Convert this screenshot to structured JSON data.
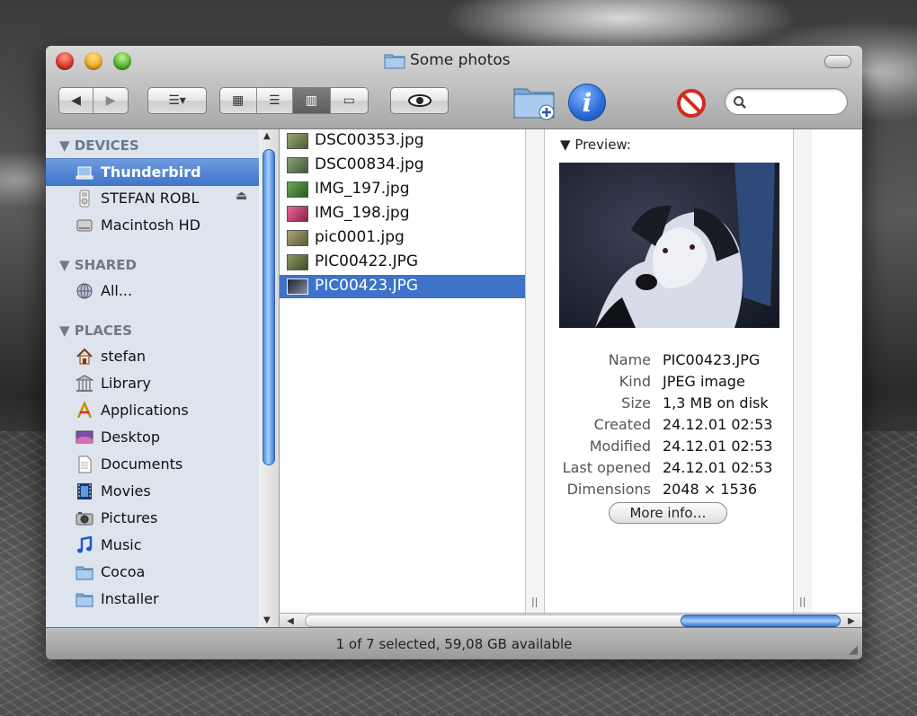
{
  "window": {
    "title": "Some photos"
  },
  "toolbar": {
    "back_label": "◀",
    "forward_label": "▶",
    "arrange_label": "☰▾",
    "view_icons": "▦",
    "view_list": "☰",
    "view_columns": "▥",
    "view_coverflow": "▭",
    "quicklook": "👁",
    "new_folder_icon": "folder-plus-icon",
    "info_label": "i",
    "delete_icon": "no-entry-icon",
    "search": {
      "value": "",
      "placeholder": ""
    }
  },
  "sidebar": {
    "sections": [
      {
        "header": "DEVICES",
        "items": [
          {
            "label": "Thunderbird",
            "icon": "laptop-icon",
            "selected": true
          },
          {
            "label": "STEFAN ROBL",
            "icon": "ipod-icon",
            "eject": true
          },
          {
            "label": "Macintosh HD",
            "icon": "hard-drive-icon"
          }
        ]
      },
      {
        "header": "SHARED",
        "items": [
          {
            "label": "All...",
            "icon": "network-globe-icon"
          }
        ]
      },
      {
        "header": "PLACES",
        "items": [
          {
            "label": "stefan",
            "icon": "home-icon"
          },
          {
            "label": "Library",
            "icon": "library-icon"
          },
          {
            "label": "Applications",
            "icon": "applications-icon"
          },
          {
            "label": "Desktop",
            "icon": "desktop-icon"
          },
          {
            "label": "Documents",
            "icon": "documents-icon"
          },
          {
            "label": "Movies",
            "icon": "film-icon"
          },
          {
            "label": "Pictures",
            "icon": "camera-icon"
          },
          {
            "label": "Music",
            "icon": "music-note-icon"
          },
          {
            "label": "Cocoa",
            "icon": "folder-icon"
          },
          {
            "label": "Installer",
            "icon": "folder-icon"
          }
        ]
      }
    ]
  },
  "files": [
    {
      "name": "DSC00353.jpg",
      "thumb_color": "#6b7c4a"
    },
    {
      "name": "DSC00834.jpg",
      "thumb_color": "#5d7a52"
    },
    {
      "name": "IMG_197.jpg",
      "thumb_color": "#3f7a35"
    },
    {
      "name": "IMG_198.jpg",
      "thumb_color": "#c2446d"
    },
    {
      "name": "pic0001.jpg",
      "thumb_color": "#7c7e55"
    },
    {
      "name": "PIC00422.JPG",
      "thumb_color": "#5a6a40"
    },
    {
      "name": "PIC00423.JPG",
      "thumb_color": "#2b3244",
      "selected": true
    }
  ],
  "preview": {
    "title": "Preview:",
    "info": [
      {
        "key": "Name",
        "value": "PIC00423.JPG"
      },
      {
        "key": "Kind",
        "value": "JPEG image"
      },
      {
        "key": "Size",
        "value": "1,3 MB on disk"
      },
      {
        "key": "Created",
        "value": "24.12.01 02:53"
      },
      {
        "key": "Modified",
        "value": "24.12.01 02:53"
      },
      {
        "key": "Last opened",
        "value": "24.12.01 02:53"
      },
      {
        "key": "Dimensions",
        "value": "2048 × 1536"
      }
    ],
    "more_label": "More info…"
  },
  "status": {
    "text": "1 of 7 selected, 59,08 GB available"
  },
  "colors": {
    "selection": "#3e73c9",
    "sidebar_bg": "#dde4ee",
    "accent": "#4a8ce3"
  }
}
